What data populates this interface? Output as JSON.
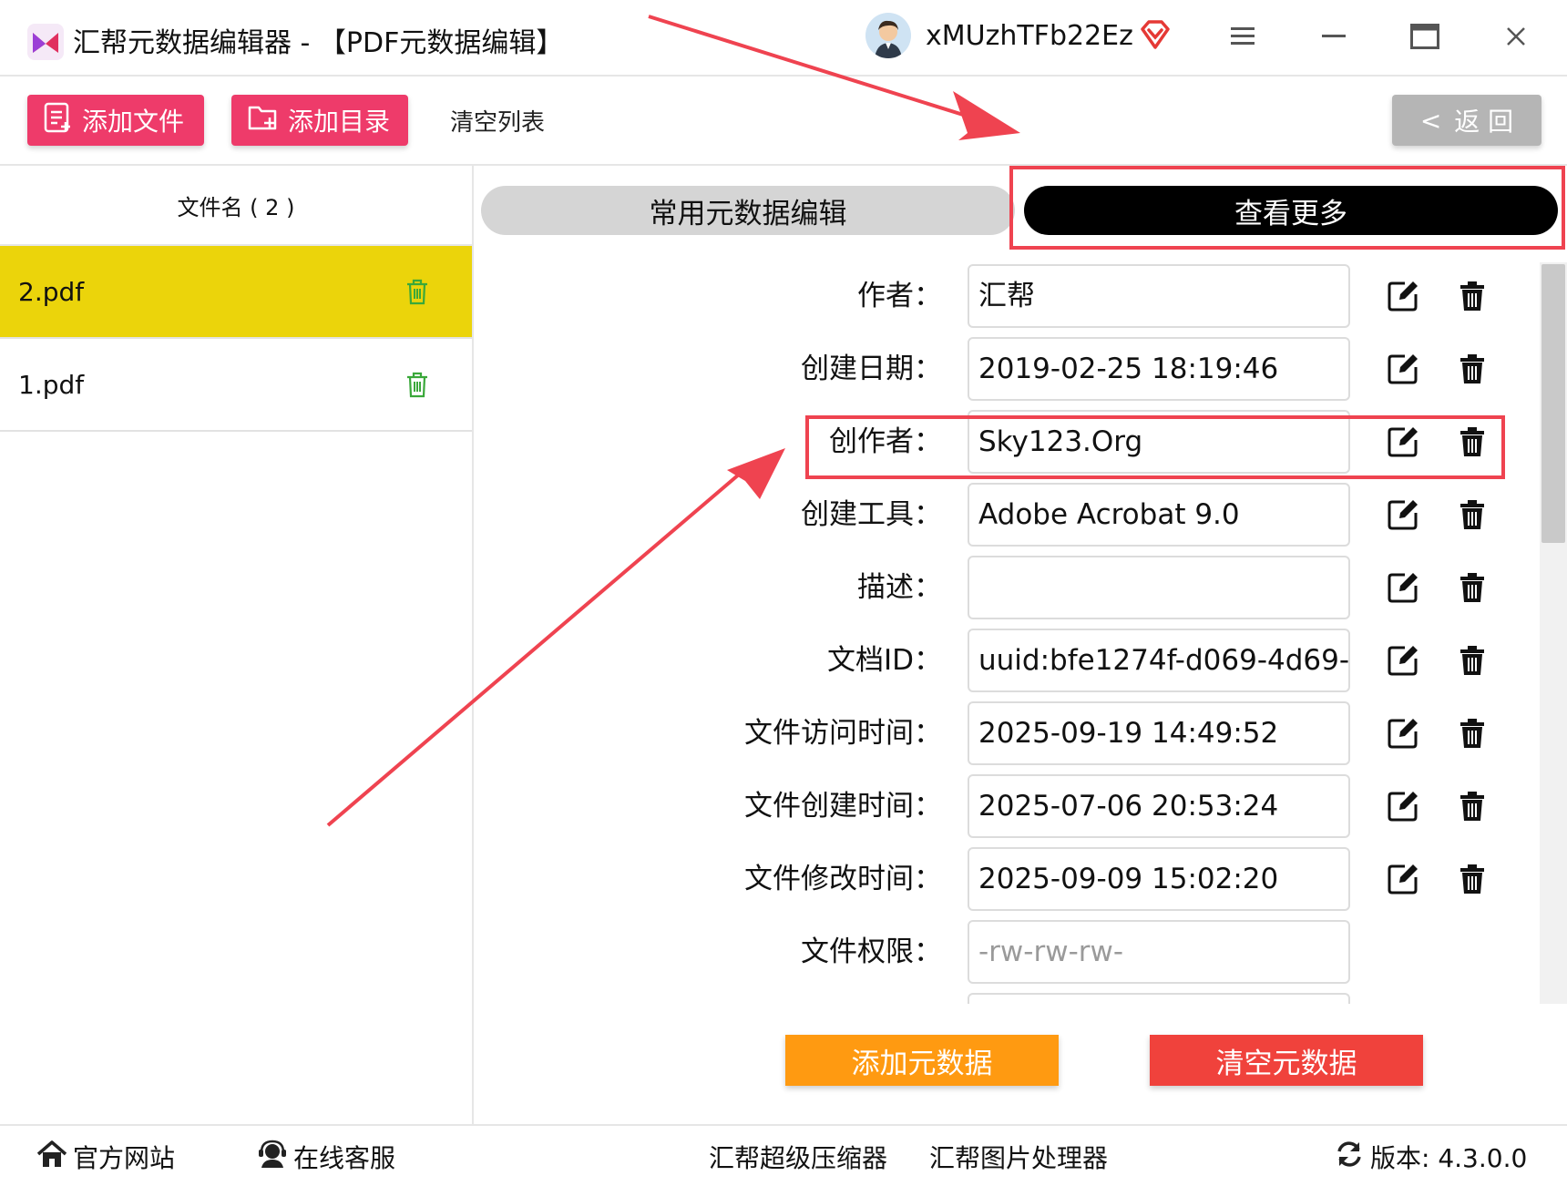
{
  "window": {
    "title": "汇帮元数据编辑器 - 【PDF元数据编辑】",
    "username": "xMUzhTFb22Ez"
  },
  "toolbar": {
    "add_file": "添加文件",
    "add_dir": "添加目录",
    "clear_list": "清空列表",
    "back": "返 回",
    "back_chevron": "<"
  },
  "file_list": {
    "header": "文件名 ( 2 )",
    "files": [
      {
        "name": "2.pdf",
        "selected": true
      },
      {
        "name": "1.pdf",
        "selected": false
      }
    ]
  },
  "tabs": {
    "common": "常用元数据编辑",
    "more": "查看更多",
    "active": "more"
  },
  "metadata": [
    {
      "label": "作者：",
      "value": "汇帮"
    },
    {
      "label": "创建日期：",
      "value": "2019-02-25 18:19:46"
    },
    {
      "label": "创作者：",
      "value": "Sky123.Org"
    },
    {
      "label": "创建工具：",
      "value": "Adobe Acrobat 9.0"
    },
    {
      "label": "描述：",
      "value": ""
    },
    {
      "label": "文档ID：",
      "value": "uuid:bfe1274f-d069-4d69-"
    },
    {
      "label": "文件访问时间：",
      "value": "2025-09-19 14:49:52"
    },
    {
      "label": "文件创建时间：",
      "value": "2025-07-06 20:53:24"
    },
    {
      "label": "文件修改时间：",
      "value": "2025-09-09 15:02:20"
    },
    {
      "label": "文件权限：",
      "value": "-rw-rw-rw-"
    }
  ],
  "actions": {
    "add_meta": "添加元数据",
    "clear_meta": "清空元数据"
  },
  "footer": {
    "website": "官方网站",
    "support": "在线客服",
    "compressor": "汇帮超级压缩器",
    "image_tool": "汇帮图片处理器",
    "version": "版本:  4.3.0.0"
  },
  "colors": {
    "accent_pink": "#ee3b6a",
    "selected_row": "#ebd40b",
    "highlight_red": "#ef4350",
    "add_meta": "#ff9a11",
    "clear_meta": "#f0423c",
    "trash_green": "#3aa83a"
  },
  "icons": {
    "edit": "edit-icon",
    "delete": "delete-icon",
    "trash": "trash-icon",
    "home": "home-icon",
    "support": "headset-icon",
    "refresh": "refresh-icon"
  }
}
